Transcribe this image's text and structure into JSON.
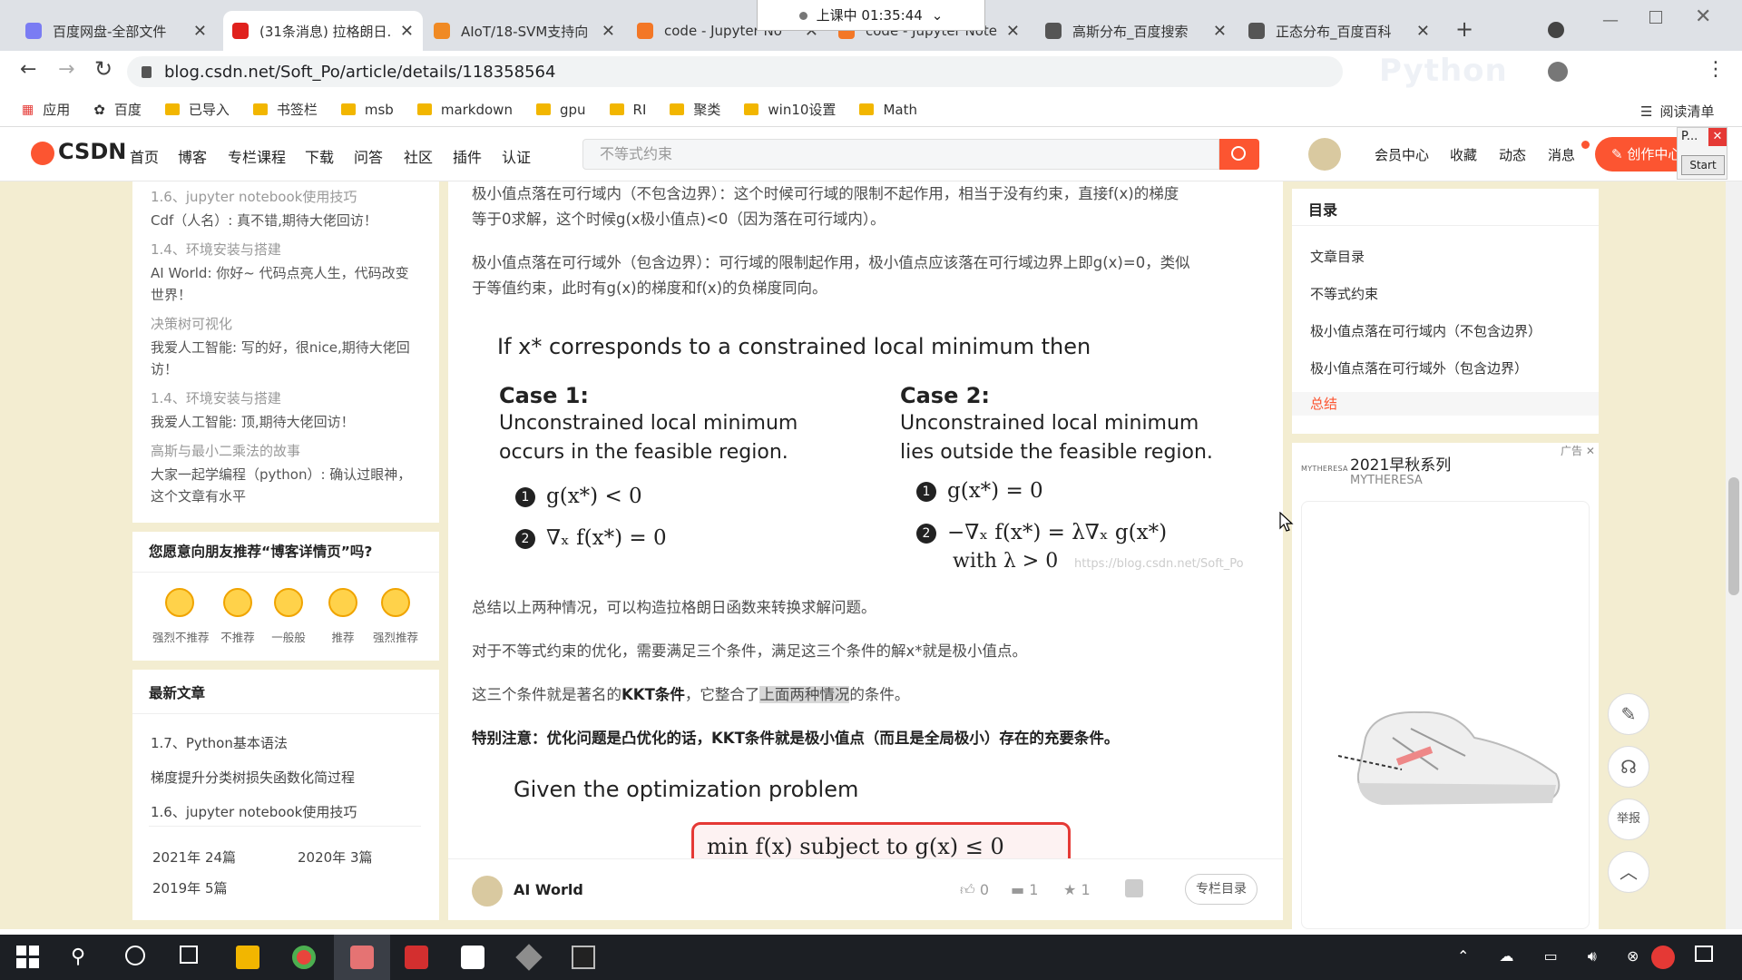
{
  "tabs": [
    {
      "title": "百度网盘-全部文件",
      "fav": "#7a7cf3"
    },
    {
      "title": "(31条消息) 拉格朗日...",
      "fav": "#e0211d"
    },
    {
      "title": "AIoT/18-SVM支持向",
      "fav": "#f08a24"
    },
    {
      "title": "code - Jupyter No",
      "fav": "#f37726"
    },
    {
      "title": "code - Jupyter Note",
      "fav": "#f37726"
    },
    {
      "title": "高斯分布_百度搜索",
      "fav": "#555"
    },
    {
      "title": "正态分布_百度百科",
      "fav": "#555"
    }
  ],
  "class_timer": "上课中 01:35:44",
  "url": "blog.csdn.net/Soft_Po/article/details/118358564",
  "watermark": "Python",
  "bookmarks": [
    "应用",
    "百度",
    "已导入",
    "书签栏",
    "msb",
    "markdown",
    "gpu",
    "RI",
    "聚类",
    "win10设置",
    "Math"
  ],
  "reading_list": "阅读清单",
  "csdn": {
    "logo": "CSDN",
    "nav": [
      "首页",
      "博客",
      "专栏课程",
      "下载",
      "问答",
      "社区",
      "插件",
      "认证"
    ],
    "search_placeholder": "不等式约束",
    "right": [
      "会员中心",
      "收藏",
      "动态",
      "消息"
    ],
    "create": "创作中心",
    "mini_popup": "P...",
    "mini_start": "Start"
  },
  "comments": [
    {
      "t": "1.6、jupyter notebook使用技巧",
      "g": true
    },
    {
      "t": "Cdf（人名）: 真不错,期待大佬回访！",
      "g": false
    },
    {
      "t": "1.4、环境安装与搭建",
      "g": true
    },
    {
      "t": "AI World: 你好~ 代码点亮人生，代码改变",
      "g": false
    },
    {
      "t": "世界！",
      "g": false
    },
    {
      "t": "决策树可视化",
      "g": true
    },
    {
      "t": "我爱人工智能: 写的好，很nice,期待大佬回",
      "g": false
    },
    {
      "t": "访！",
      "g": false
    },
    {
      "t": "1.4、环境安装与搭建",
      "g": true
    },
    {
      "t": "我爱人工智能: 顶,期待大佬回访！",
      "g": false
    },
    {
      "t": "高斯与最小二乘法的故事",
      "g": true
    },
    {
      "t": "大家一起学编程（python）: 确认过眼神，",
      "g": false
    },
    {
      "t": "这个文章有水平",
      "g": false
    }
  ],
  "recommend": {
    "title": "您愿意向朋友推荐“博客详情页”吗?",
    "options": [
      "强烈不推荐",
      "不推荐",
      "一般般",
      "推荐",
      "强烈推荐"
    ]
  },
  "latest": {
    "title": "最新文章",
    "items": [
      "1.7、Python基本语法",
      "梯度提升分类树损失函数化简过程",
      "1.6、jupyter notebook使用技巧"
    ],
    "archive": [
      "2021年 24篇",
      "2020年 3篇",
      "2019年 5篇"
    ]
  },
  "article": {
    "p1a": "极小值点落在可行域内（不包含边界）：这个时候可行域的限制不起作用，相当于没有约束，直接f(x)的梯度",
    "p1b": "等于0求解，这个时候g(x极小值点)<0（因为落在可行域内）。",
    "p2a": "极小值点落在可行域外（包含边界）：可行域的限制起作用，极小值点应该落在可行域边界上即g(x)=0，类似",
    "p2b": "于等值约束，此时有g(x)的梯度和f(x)的负梯度同向。",
    "fig_title": "If x* corresponds to a constrained local minimum then",
    "case1_title": "Case 1:",
    "case1_l1": "Unconstrained local minimum",
    "case1_l2": "occurs in the feasible region.",
    "case1_e1": "g(x*) < 0",
    "case1_e2": "∇ₓ f(x*) = 0",
    "case2_title": "Case 2:",
    "case2_l1": "Unconstrained local minimum",
    "case2_l2": "lies outside the feasible region.",
    "case2_e1": "g(x*) = 0",
    "case2_e2": "−∇ₓ f(x*) = λ∇ₓ g(x*)",
    "case2_e3": "with λ > 0",
    "img_watermark": "https://blog.csdn.net/Soft_Po",
    "p3": "总结以上两种情况，可以构造拉格朗日函数来转换求解问题。",
    "p4": "对于不等式约束的优化，需要满足三个条件，满足这三个条件的解x*就是极小值点。",
    "p5_pre": "这三个条件就是著名的",
    "p5_bold": "KKT条件",
    "p5_mid": "，它整合了",
    "p5_hl": "上面两种情况",
    "p5_post": "的条件。",
    "p6": "特别注意：优化问题是凸优化的话，KKT条件就是极小值点（而且是全局极小）存在的充要条件。",
    "fig2_title": "Given the optimization problem",
    "fig2_box": "min f(x)  subject to  g(x) ≤ 0"
  },
  "author_bar": {
    "name": "AI World",
    "likes": "0",
    "comments": "1",
    "stars": "1",
    "column": "专栏目录"
  },
  "toc": {
    "title": "目录",
    "items": [
      "文章目录",
      "不等式约束",
      "极小值点落在可行域内（不包含边界）",
      "极小值点落在可行域外（包含边界）",
      "总结"
    ],
    "active": 4
  },
  "ad": {
    "title": "2021早秋系列",
    "sub": "MYTHERESA",
    "brand": "MYTHERESA",
    "tag": "广告"
  },
  "right_tools": {
    "report": "举报"
  }
}
